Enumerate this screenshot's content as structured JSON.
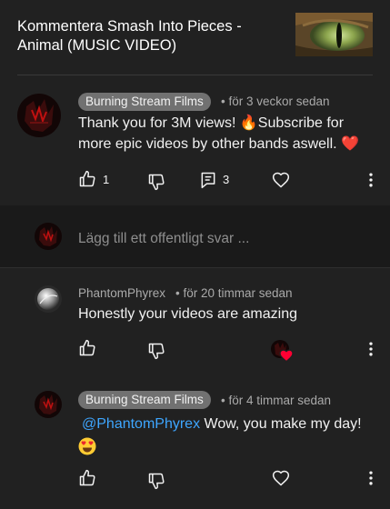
{
  "header": {
    "title": "Kommentera Smash Into Pieces - Animal (MUSIC VIDEO)"
  },
  "top_comment": {
    "author": "Burning Stream Films",
    "time": "• för 3 veckor sedan",
    "text": "Thank you for 3M views! 🔥Subscribe for more epic videos by other bands aswell. ❤️",
    "likes": "1",
    "replies": "3"
  },
  "reply_input": {
    "placeholder": "Lägg till ett offentligt svar ..."
  },
  "replies": [
    {
      "author": "PhantomPhyrex",
      "time": "• för 20 timmar sedan",
      "text": "Honestly your videos are amazing"
    },
    {
      "author": "Burning Stream Films",
      "time": "• för 4 timmar sedan",
      "mention": "@PhantomPhyrex",
      "text": " Wow, you make my day!",
      "emoji": "😍"
    }
  ],
  "icons": [
    "thumb-up-icon",
    "thumb-down-icon",
    "comment-icon",
    "heart-icon",
    "more-vert-icon",
    "creator-heart-icon"
  ],
  "colors": {
    "background": "#212121",
    "chip": "#717171",
    "mention": "#3ea6ff",
    "heart": "#ff0033"
  }
}
